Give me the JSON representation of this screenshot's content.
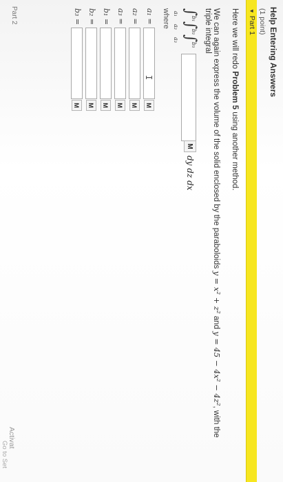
{
  "header": {
    "title": "Help Entering Answers",
    "points": "(1 point)"
  },
  "part": {
    "label": "Part 1"
  },
  "problem": {
    "line1_pre": "Here we will redo ",
    "line1_bold": "Problem 5",
    "line1_post": " using another method.",
    "line2_text": "We can again express the volume of the solid enclosed by the paraboloids ",
    "eq1": "y = x² + z²",
    "and": " and ",
    "eq2": "y = 45 − 4x² − 4z²",
    "line2_end": ", with the",
    "line3": "triple integral"
  },
  "integrals": [
    {
      "upper": "b₁",
      "lower": "a₁"
    },
    {
      "upper": "b₂",
      "lower": "a₂"
    },
    {
      "upper": "b₃",
      "lower": "a₃"
    }
  ],
  "integrand": {
    "value": "",
    "differential": "dy dz dx",
    "math_button": "M"
  },
  "where_label": "where",
  "limits": [
    {
      "label": "a₁ =",
      "value": "",
      "button": "M"
    },
    {
      "label": "a₂ =",
      "value": "",
      "button": "M"
    },
    {
      "label": "a₃ =",
      "value": "",
      "button": "M"
    },
    {
      "label": "b₁ =",
      "value": "",
      "button": "M"
    },
    {
      "label": "b₂ =",
      "value": "",
      "button": "M"
    },
    {
      "label": "b₃ =",
      "value": "",
      "button": "M"
    }
  ],
  "footer": {
    "part2": "Part 2",
    "activate": "Activat",
    "goto": "Go to Set"
  }
}
